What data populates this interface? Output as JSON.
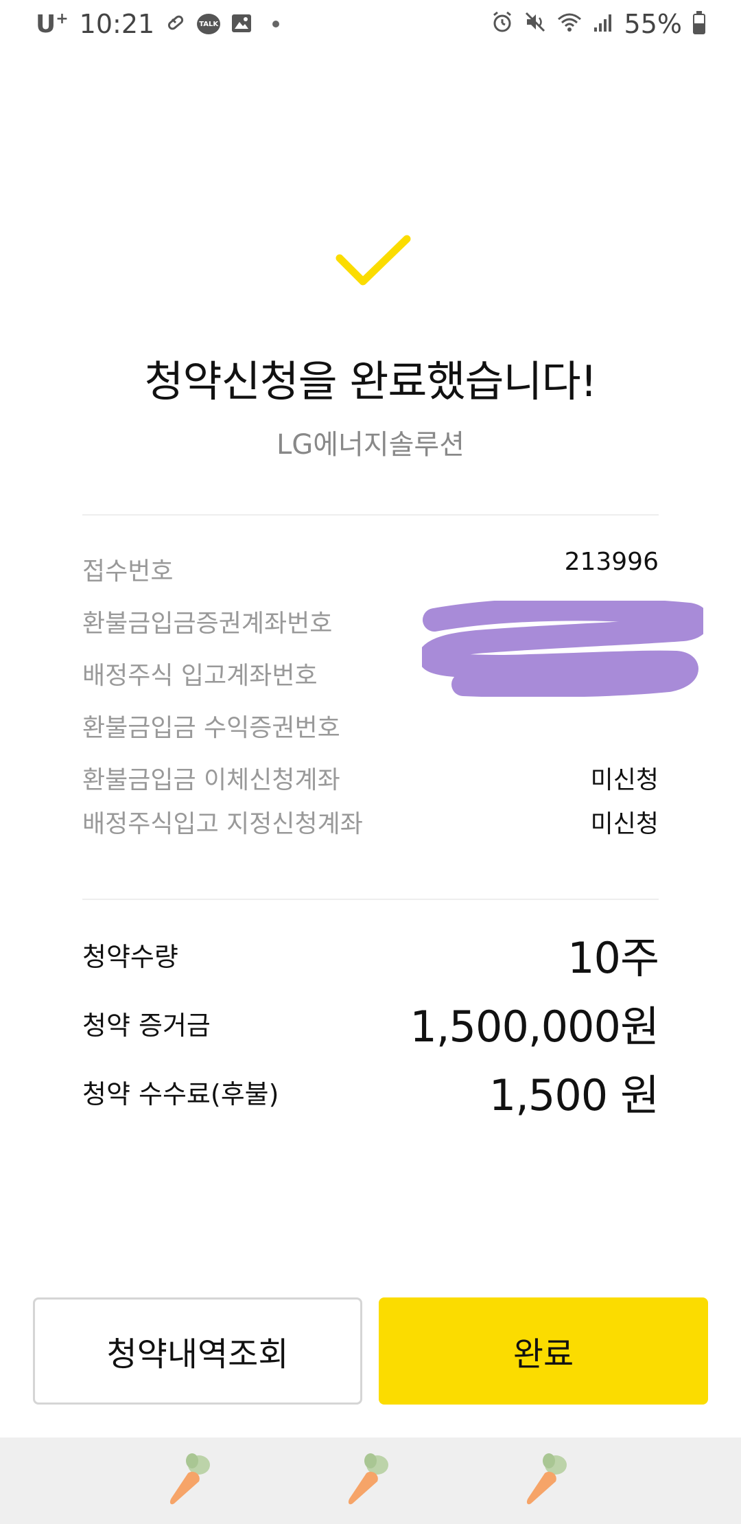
{
  "status_bar": {
    "carrier": "U",
    "carrier_sup": "+",
    "time": "10:21",
    "talk_badge": "TALK",
    "battery": "55%",
    "battery_level": 0.55
  },
  "header": {
    "title": "청약신청을 완료했습니다!",
    "company": "LG에너지솔루션"
  },
  "info": [
    {
      "label": "접수번호",
      "value": "213996"
    },
    {
      "label": "환불금입금증권계좌번호",
      "value": ""
    },
    {
      "label": "배정주식 입고계좌번호",
      "value": ""
    },
    {
      "label": "환불금입금 수익증권번호",
      "value": ""
    },
    {
      "label": "환불금입금 이체신청계좌",
      "value": "미신청"
    },
    {
      "label": "배정주식입고 지정신청계좌",
      "value": "미신청"
    }
  ],
  "amounts": [
    {
      "label": "청약수량",
      "value": "10주"
    },
    {
      "label": "청약 증거금",
      "value": "1,500,000원"
    },
    {
      "label": "청약 수수료(후불)",
      "value": "1,500 원"
    }
  ],
  "buttons": {
    "history": "청약내역조회",
    "done": "완료"
  },
  "colors": {
    "accent": "#fbdc00",
    "check": "#fbdc00",
    "redaction": "#a385d6"
  }
}
